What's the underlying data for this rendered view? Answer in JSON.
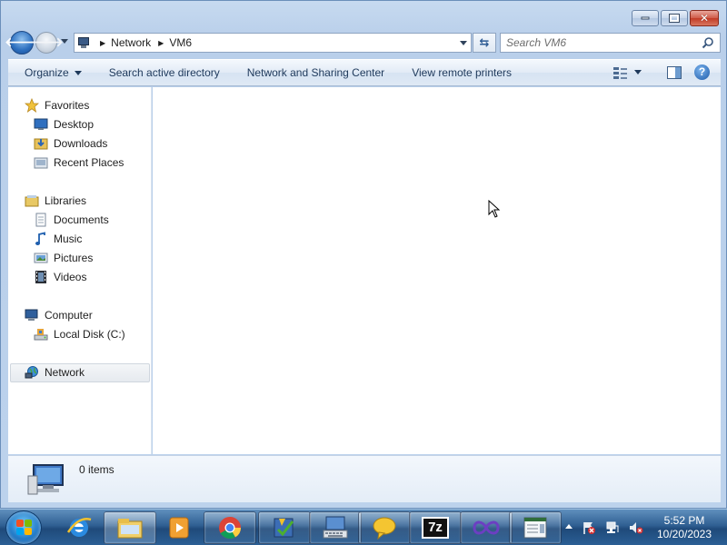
{
  "window": {
    "caption": {
      "minimize": "minimize",
      "maximize": "maximize",
      "close": "close"
    }
  },
  "navigation": {
    "breadcrumbs": [
      "Network",
      "VM6"
    ],
    "search": {
      "placeholder": "Search VM6"
    }
  },
  "toolbar": {
    "organize": "Organize",
    "search_ad": "Search active directory",
    "sharing_center": "Network and Sharing Center",
    "remote_printers": "View remote printers"
  },
  "sidebar": {
    "favorites": {
      "label": "Favorites",
      "items": [
        {
          "label": "Desktop",
          "icon": "desktop-icon"
        },
        {
          "label": "Downloads",
          "icon": "downloads-icon"
        },
        {
          "label": "Recent Places",
          "icon": "recent-places-icon"
        }
      ]
    },
    "libraries": {
      "label": "Libraries",
      "items": [
        {
          "label": "Documents",
          "icon": "documents-icon"
        },
        {
          "label": "Music",
          "icon": "music-icon"
        },
        {
          "label": "Pictures",
          "icon": "pictures-icon"
        },
        {
          "label": "Videos",
          "icon": "videos-icon"
        }
      ]
    },
    "computer": {
      "label": "Computer",
      "items": [
        {
          "label": "Local Disk (C:)",
          "icon": "local-disk-icon"
        }
      ]
    },
    "network": {
      "label": "Network",
      "selected": true
    }
  },
  "details": {
    "count": "0 items"
  },
  "taskbar": {
    "pinned": [
      "internet-explorer-icon",
      "windows-explorer-icon",
      "media-player-icon",
      "chrome-icon",
      "task-checklist-icon",
      "keyboard-app-icon",
      "chat-bubble-icon",
      "7zip-icon",
      "infinity-app-icon",
      "document-app-icon"
    ],
    "seven_zip_label": "7z",
    "clock": {
      "time": "5:52 PM",
      "date": "10/20/2023"
    }
  },
  "colors": {
    "chrome_blue": "#bcd2ec",
    "command_text": "#1e395b",
    "taskbar": "#2f5f92",
    "selection": "#e6eaef"
  }
}
